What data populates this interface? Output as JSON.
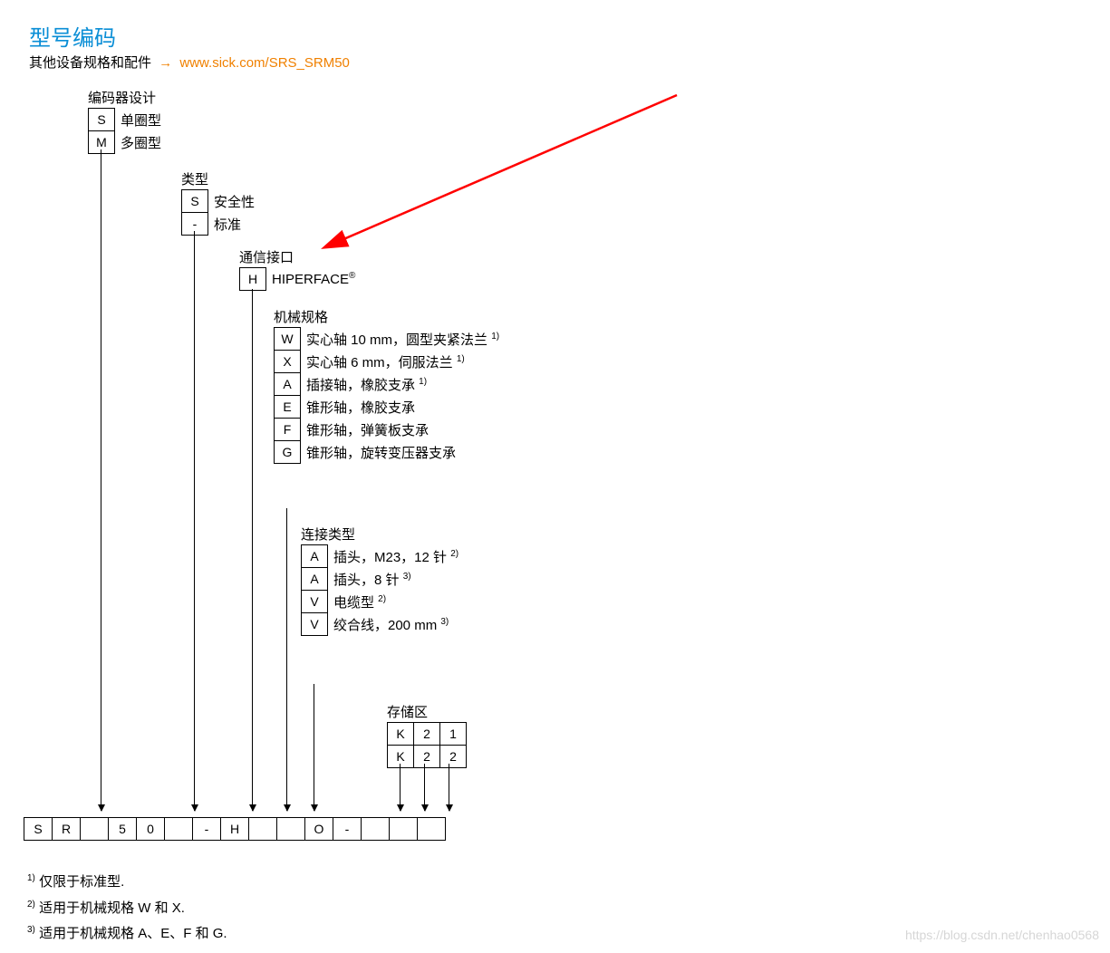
{
  "title": "型号编码",
  "subtitle_prefix": "其他设备规格和配件",
  "subtitle_link": "www.sick.com/SRS_SRM50",
  "groups": {
    "g1": {
      "header": "编码器设计",
      "opts": [
        {
          "code": "S",
          "text": "单圈型"
        },
        {
          "code": "M",
          "text": "多圈型"
        }
      ]
    },
    "g2": {
      "header": "类型",
      "opts": [
        {
          "code": "S",
          "text": "安全性"
        },
        {
          "code": "-",
          "text": "标准"
        }
      ]
    },
    "g3": {
      "header": "通信接口",
      "opts": [
        {
          "code": "H",
          "text": "HIPERFACE"
        }
      ]
    },
    "g4": {
      "header": "机械规格",
      "opts": [
        {
          "code": "W",
          "text": "实心轴 10 mm，圆型夹紧法兰",
          "note": "1)"
        },
        {
          "code": "X",
          "text": "实心轴 6 mm，伺服法兰",
          "note": "1)"
        },
        {
          "code": "A",
          "text": "插接轴，橡胶支承",
          "note": "1)"
        },
        {
          "code": "E",
          "text": "锥形轴，橡胶支承"
        },
        {
          "code": "F",
          "text": "锥形轴，弹簧板支承"
        },
        {
          "code": "G",
          "text": "锥形轴，旋转变压器支承"
        }
      ]
    },
    "g5": {
      "header": "连接类型",
      "opts": [
        {
          "code": "A",
          "text": "插头，M23，12 针",
          "note": "2)"
        },
        {
          "code": "A",
          "text": "插头，8 针",
          "note": "3)"
        },
        {
          "code": "V",
          "text": "电缆型",
          "note": "2)"
        },
        {
          "code": "V",
          "text": "绞合线，200 mm",
          "note": "3)"
        }
      ]
    },
    "g6": {
      "header": "存储区",
      "rows": [
        [
          "K",
          "2",
          "1"
        ],
        [
          "K",
          "2",
          "2"
        ]
      ]
    }
  },
  "bottom": [
    "S",
    "R",
    "",
    "5",
    "0",
    "",
    "-",
    "H",
    "",
    "",
    "O",
    "-",
    "",
    "",
    ""
  ],
  "footnotes": [
    {
      "n": "1)",
      "t": "仅限于标准型."
    },
    {
      "n": "2)",
      "t": "适用于机械规格 W 和 X."
    },
    {
      "n": "3)",
      "t": "适用于机械规格 A、E、F 和 G."
    }
  ],
  "watermark": "https://blog.csdn.net/chenhao0568"
}
